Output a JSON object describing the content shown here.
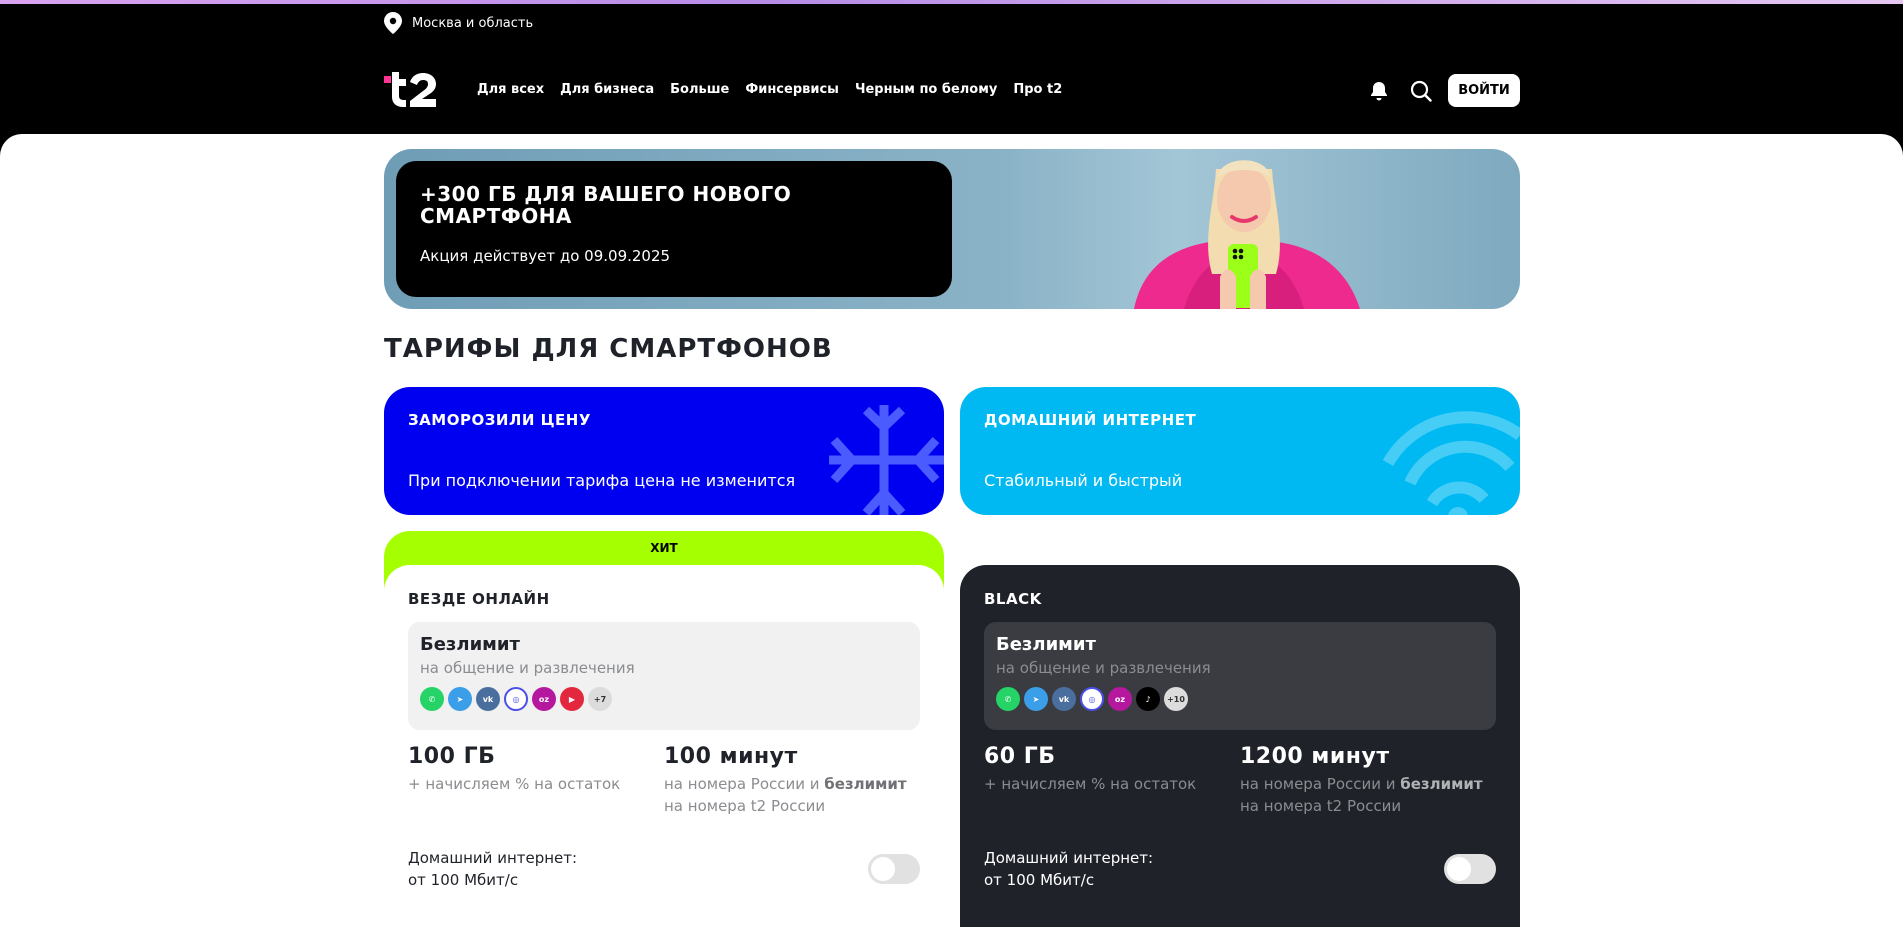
{
  "header": {
    "region": "Москва и область",
    "nav": [
      "Для всех",
      "Для бизнеса",
      "Больше",
      "Финсервисы",
      "Черным по белому",
      "Про t2"
    ],
    "login": "ВОЙТИ"
  },
  "banner": {
    "title": "+300 ГБ ДЛЯ ВАШЕГО НОВОГО СМАРТФОНА",
    "subtitle": "Акция действует до 09.09.2025"
  },
  "section_title": "ТАРИФЫ ДЛЯ СМАРТФОНОВ",
  "promos": [
    {
      "title": "ЗАМОРОЗИЛИ ЦЕНУ",
      "subtitle": "При подключении тарифа цена не изменится",
      "color": "#0000f0"
    },
    {
      "title": "ДОМАШНИЙ ИНТЕРНЕТ",
      "subtitle": "Стабильный и быстрый",
      "color": "#00b9f2"
    }
  ],
  "cards": [
    {
      "badge": "ХИТ",
      "title": "ВЕЗДЕ ОНЛАЙН",
      "unlim_title": "Безлимит",
      "unlim_sub": "на общение и развлечения",
      "more_apps": "+7",
      "data_val": "100 ГБ",
      "data_sub": "+ начисляем % на остаток",
      "min_val": "100 минут",
      "min_sub_a": "на номера России и ",
      "min_sub_b": "безлимит",
      "min_sub_c": "на номера t2 России",
      "home_a": "Домашний интернет:",
      "home_b": "от 100 Мбит/с"
    },
    {
      "title": "BLACK",
      "unlim_title": "Безлимит",
      "unlim_sub": "на общение и развлечения",
      "more_apps": "+10",
      "data_val": "60 ГБ",
      "data_sub": "+ начисляем % на остаток",
      "min_val": "1200 минут",
      "min_sub_a": "на номера России и ",
      "min_sub_b": "безлимит",
      "min_sub_c": "на номера t2 России",
      "home_a": "Домашний интернет:",
      "home_b": "от 100 Мбит/с"
    }
  ],
  "app_icons": {
    "card1": [
      "whatsapp-icon",
      "telegram-icon",
      "vk-icon",
      "max-icon",
      "ozon-icon",
      "youtube-icon"
    ],
    "card2": [
      "whatsapp-icon",
      "telegram-icon",
      "vk-icon",
      "max-icon",
      "ozon-icon",
      "tiktok-icon"
    ]
  },
  "colors": {
    "accent": "#a5ff00",
    "blue": "#0000f0",
    "cyan": "#00b9f2",
    "dark": "#1f2229"
  }
}
